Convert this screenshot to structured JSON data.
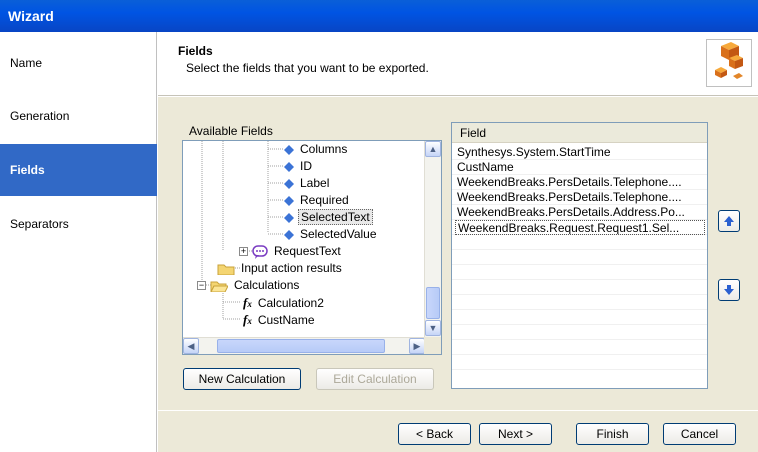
{
  "window": {
    "title": "Wizard"
  },
  "sidebar": {
    "items": [
      {
        "label": "Name",
        "active": false
      },
      {
        "label": "Generation",
        "active": false
      },
      {
        "label": "Fields",
        "active": true
      },
      {
        "label": "Separators",
        "active": false
      }
    ]
  },
  "header": {
    "title": "Fields",
    "subtitle": "Select the fields that you want to be exported."
  },
  "available": {
    "label": "Available Fields",
    "tree": [
      {
        "label": "Columns",
        "icon": "blue-diamond-icon"
      },
      {
        "label": "ID",
        "icon": "blue-diamond-icon"
      },
      {
        "label": "Label",
        "icon": "blue-diamond-icon"
      },
      {
        "label": "Required",
        "icon": "blue-diamond-icon"
      },
      {
        "label": "SelectedText",
        "icon": "blue-diamond-icon",
        "selected": true
      },
      {
        "label": "SelectedValue",
        "icon": "blue-diamond-icon"
      },
      {
        "label": "RequestText",
        "icon": "request-icon",
        "expander": "+"
      },
      {
        "label": "Input action results",
        "icon": "folder-icon"
      },
      {
        "label": "Calculations",
        "icon": "folder-open-icon",
        "expander": "-"
      },
      {
        "label": "Calculation2",
        "icon": "function-icon"
      },
      {
        "label": "CustName",
        "icon": "function-icon"
      }
    ]
  },
  "fields": {
    "header": "Field",
    "rows": [
      "Synthesys.System.StartTime",
      "CustName",
      "WeekendBreaks.PersDetails.Telephone....",
      "WeekendBreaks.PersDetails.Telephone....",
      "WeekendBreaks.PersDetails.Address.Po...",
      "WeekendBreaks.Request.Request1.Sel..."
    ]
  },
  "buttons": {
    "new_calc": "New Calculation",
    "edit_calc": "Edit Calculation",
    "back": "< Back",
    "next": "Next >",
    "finish": "Finish",
    "cancel": "Cancel"
  },
  "colors": {
    "titlebar": "#0054e3",
    "sidebar_active": "#3169c6",
    "panel_bg": "#ece9d8"
  }
}
